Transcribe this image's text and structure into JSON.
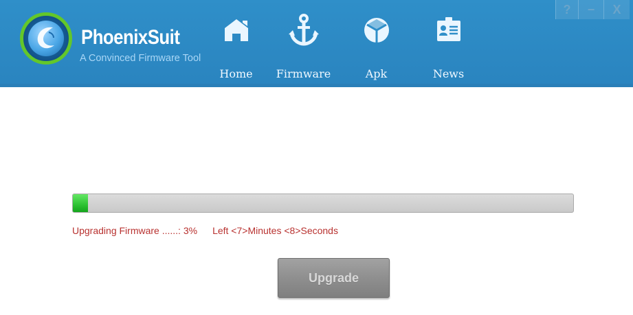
{
  "app": {
    "name": "PhoenixSuit",
    "subtitle": "A Convinced Firmware Tool"
  },
  "nav": [
    {
      "label": "Home",
      "icon": "home-icon"
    },
    {
      "label": "Firmware",
      "icon": "anchor-icon"
    },
    {
      "label": "Apk",
      "icon": "box-icon"
    },
    {
      "label": "News",
      "icon": "news-icon"
    }
  ],
  "window_controls": {
    "help": "?",
    "minimize": "−",
    "close": "X"
  },
  "progress": {
    "percent": 3,
    "status_text": "Upgrading Firmware ......: 3%",
    "time_left_text": "Left <7>Minutes <8>Seconds"
  },
  "upgrade_button": {
    "label": "Upgrade"
  },
  "colors": {
    "header": "#2f8fc9",
    "status_text": "#b8312f",
    "progress_green": "#2dc233"
  }
}
